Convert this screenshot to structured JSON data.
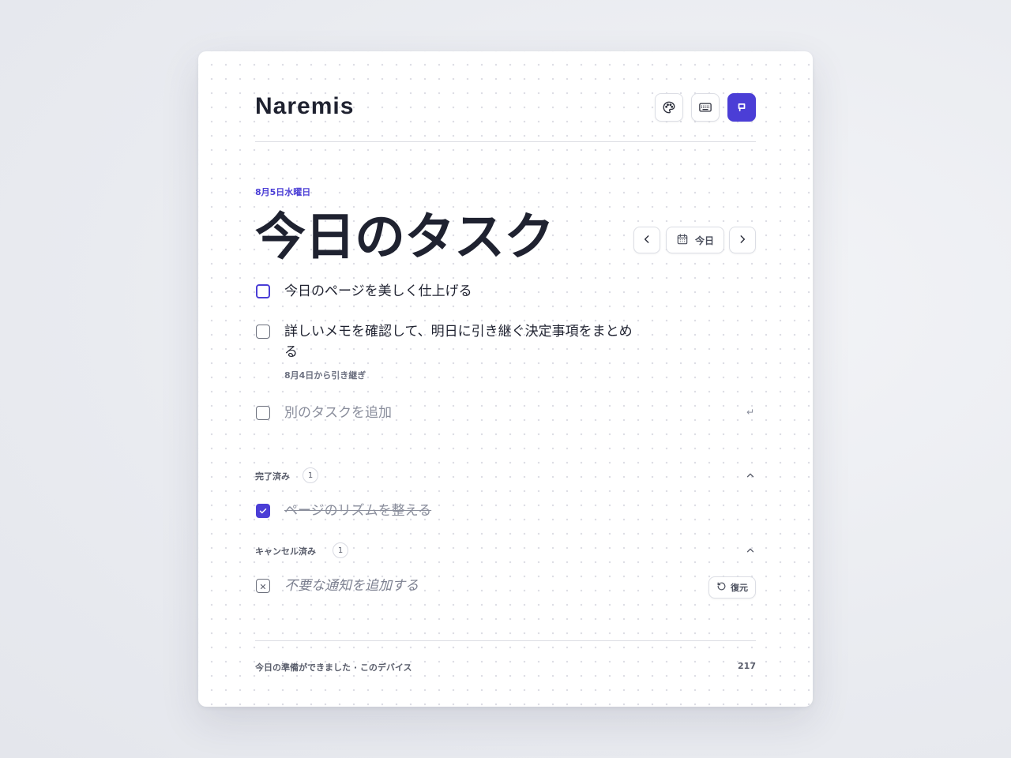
{
  "app": {
    "title": "Naremis"
  },
  "toolbar": {
    "theme_icon": "palette-icon",
    "keyboard_icon": "keyboard-icon",
    "focus_icon": "focus-window-icon"
  },
  "header": {
    "date_label": "8月5日水曜日",
    "title": "今日のタスク",
    "today_label": "今日"
  },
  "tasks": [
    {
      "text": "今日のページを美しく仕上げる"
    },
    {
      "text": "詳しいメモを確認して、明日に引き継ぐ決定事項をまとめる",
      "sub": "8月4日から引き継ぎ"
    }
  ],
  "add_task": {
    "placeholder": "別のタスクを追加",
    "enter_hint": "↵"
  },
  "completed": {
    "label": "完了済み",
    "count": "1",
    "items": [
      {
        "text": "ページのリズムを整える"
      }
    ]
  },
  "cancelled": {
    "label": "キャンセル済み",
    "count": "1",
    "items": [
      {
        "text": "不要な通知を追加する",
        "restore_label": "復元"
      }
    ]
  },
  "footer": {
    "status": "今日の準備ができました · このデバイス",
    "count": "217"
  },
  "colors": {
    "accent": "#4b3ed6",
    "text": "#1f2230",
    "muted": "#8a8e9c"
  }
}
